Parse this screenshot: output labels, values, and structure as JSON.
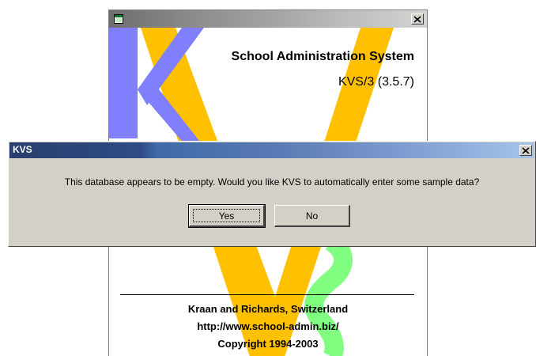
{
  "splash": {
    "product_name": "School Administration System",
    "version": "KVS/3 (3.5.7)",
    "credits": [
      "Kraan and Richards, Switzerland",
      "http://www.school-admin.biz/",
      "Copyright 1994-2003"
    ],
    "logo_letters": [
      "K",
      "V",
      "S"
    ],
    "colors": {
      "k": "#8080ff",
      "v": "#ffc000",
      "s": "#80ff80"
    }
  },
  "dialog": {
    "title": "KVS",
    "message": "This database appears to be empty. Would you like KVS to automatically enter some sample data?",
    "buttons": {
      "yes": "Yes",
      "no": "No"
    }
  },
  "icons": {
    "splash_app": "window-app-icon",
    "close": "close-icon"
  }
}
